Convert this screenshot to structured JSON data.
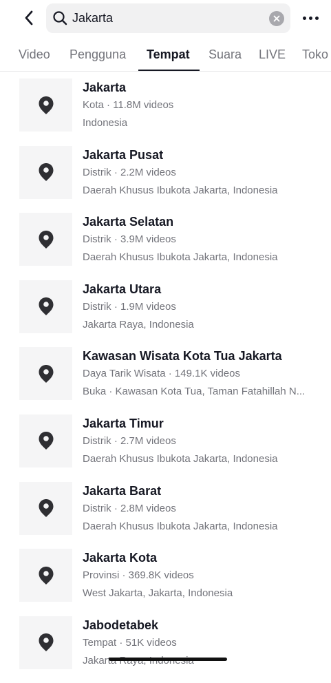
{
  "search": {
    "query": "Jakarta"
  },
  "tabs": [
    {
      "label": "Video",
      "active": false
    },
    {
      "label": "Pengguna",
      "active": false
    },
    {
      "label": "Tempat",
      "active": true
    },
    {
      "label": "Suara",
      "active": false
    },
    {
      "label": "LIVE",
      "active": false
    },
    {
      "label": "Toko",
      "active": false
    }
  ],
  "places": [
    {
      "name": "Jakarta",
      "meta": "Kota · 11.8M videos",
      "address": "Indonesia"
    },
    {
      "name": "Jakarta Pusat",
      "meta": "Distrik · 2.2M videos",
      "address": "Daerah Khusus Ibukota Jakarta, Indonesia"
    },
    {
      "name": "Jakarta Selatan",
      "meta": "Distrik · 3.9M videos",
      "address": "Daerah Khusus Ibukota Jakarta, Indonesia"
    },
    {
      "name": "Jakarta Utara",
      "meta": "Distrik · 1.9M videos",
      "address": "Jakarta Raya, Indonesia"
    },
    {
      "name": "Kawasan Wisata Kota Tua Jakarta",
      "meta": "Daya Tarik Wisata · 149.1K videos",
      "address": "Buka · Kawasan Kota Tua, Taman Fatahillah N..."
    },
    {
      "name": "Jakarta Timur",
      "meta": "Distrik · 2.7M videos",
      "address": "Daerah Khusus Ibukota Jakarta, Indonesia"
    },
    {
      "name": "Jakarta Barat",
      "meta": "Distrik · 2.8M videos",
      "address": "Daerah Khusus Ibukota Jakarta, Indonesia"
    },
    {
      "name": "Jakarta Kota",
      "meta": "Provinsi · 369.8K videos",
      "address": "West Jakarta, Jakarta, Indonesia"
    },
    {
      "name": "Jabodetabek",
      "meta": "Tempat · 51K videos",
      "address": "Jakarta Raya, Indonesia"
    }
  ],
  "icons": {
    "back": "chevron-left-icon",
    "search": "search-icon",
    "clear": "clear-icon",
    "more": "more-icon",
    "place": "location-pin-icon"
  },
  "colors": {
    "text_primary": "#161823",
    "text_secondary": "#73747b",
    "search_bg": "#f1f1f2",
    "thumb_bg": "#f5f5f6",
    "pin": "#2f2f33"
  }
}
